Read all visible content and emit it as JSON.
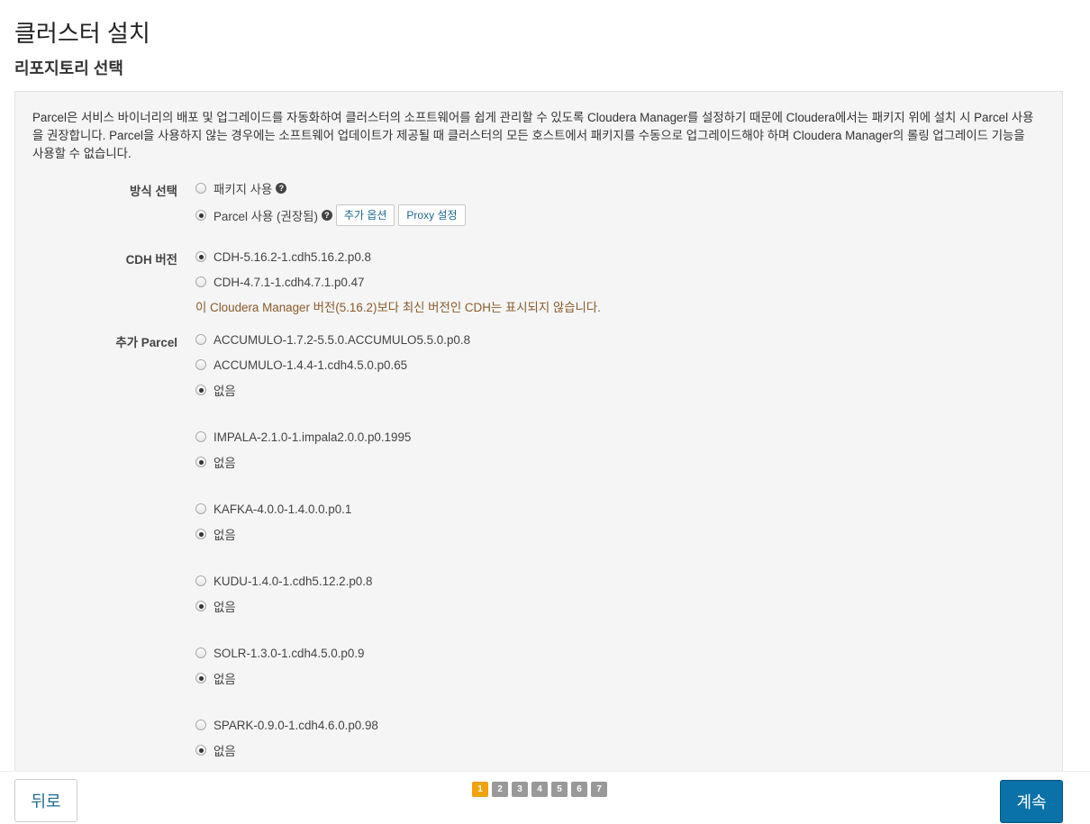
{
  "header": {
    "title": "클러스터 설치",
    "subtitle": "리포지토리 선택"
  },
  "intro": "Parcel은 서비스 바이너리의 배포 및 업그레이드를 자동화하여 클러스터의 소프트웨어를 쉽게 관리할 수 있도록 Cloudera Manager를 설정하기 때문에 Cloudera에서는 패키지 위에 설치 시 Parcel 사용을 권장합니다. Parcel을 사용하지 않는 경우에는 소프트웨어 업데이트가 제공될 때 클러스터의 모든 호스트에서 패키지를 수동으로 업그레이드해야 하며 Cloudera Manager의 롤링 업그레이드 기능을 사용할 수 없습니다.",
  "method": {
    "label": "방식 선택",
    "opt_packages": "패키지 사용",
    "opt_parcels": "Parcel 사용 (권장됨)",
    "more_options": "추가 옵션",
    "proxy": "Proxy 설정"
  },
  "cdh": {
    "label": "CDH 버전",
    "options": [
      "CDH-5.16.2-1.cdh5.16.2.p0.8",
      "CDH-4.7.1-1.cdh4.7.1.p0.47"
    ],
    "note": "이 Cloudera Manager 버전(5.16.2)보다 최신 버전인 CDH는 표시되지 않습니다."
  },
  "extra": {
    "label": "추가 Parcel",
    "none": "없음",
    "accumulo_1": "ACCUMULO-1.7.2-5.5.0.ACCUMULO5.5.0.p0.8",
    "accumulo_2": "ACCUMULO-1.4.4-1.cdh4.5.0.p0.65",
    "impala": "IMPALA-2.1.0-1.impala2.0.0.p0.1995",
    "kafka": "KAFKA-4.0.0-1.4.0.0.p0.1",
    "kudu": "KUDU-1.4.0-1.cdh5.12.2.p0.8",
    "solr": "SOLR-1.3.0-1.cdh4.5.0.p0.9",
    "spark": "SPARK-0.9.0-1.cdh4.6.0.p0.98"
  },
  "footer": {
    "back": "뒤로",
    "next": "계속",
    "steps": [
      "1",
      "2",
      "3",
      "4",
      "5",
      "6",
      "7"
    ],
    "active_step": 1
  },
  "colors": {
    "accent": "#0a72a8",
    "active_step": "#f0a30a",
    "warning_text": "#8a5a2b"
  },
  "icons": {
    "help": "help-circle-icon",
    "radio": "radio-button-icon"
  }
}
